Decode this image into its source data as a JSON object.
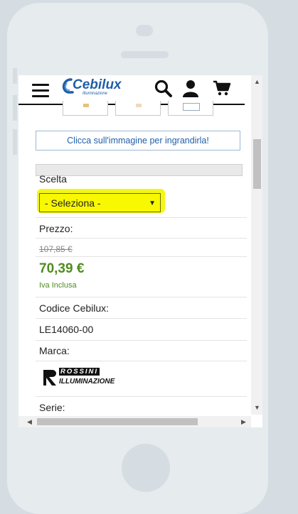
{
  "header": {
    "logo_text": "Cebilux",
    "logo_subtext": "Illuminazione",
    "icons": [
      "menu-icon",
      "search-icon",
      "user-icon",
      "cart-icon"
    ]
  },
  "product": {
    "enlarge_hint": "Clicca sull'immagine per ingrandirla!",
    "choice_label": "Scelta",
    "select_value": "- Seleziona -",
    "price_label": "Prezzo:",
    "old_price": "107,85 €",
    "price": "70,39 €",
    "vat_note": "Iva Inclusa",
    "code_label": "Codice Cebilux:",
    "code_value": "LE14060-00",
    "brand_label": "Marca:",
    "brand_logo_text_1": "ROSSINI",
    "brand_logo_text_2": "ILLUMINAZIONE",
    "series_label": "Serie:"
  },
  "colors": {
    "highlight": "#f4f714",
    "price_green": "#4e8d1e",
    "link_blue": "#1f5fa8",
    "logo_blue": "#1f5fa8"
  }
}
